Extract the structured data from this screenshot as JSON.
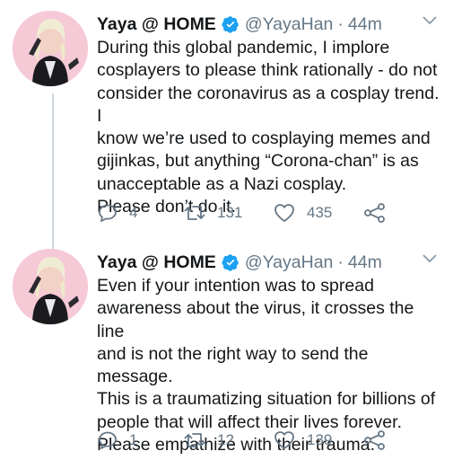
{
  "colors": {
    "text": "#14171a",
    "muted": "#657786",
    "verified": "#1da1f2",
    "thread_line": "#cfd9de"
  },
  "tweets": [
    {
      "author": {
        "name": "Yaya @ HOME",
        "handle": "@YayaHan",
        "verified_icon": "verified-badge-icon"
      },
      "separator": "·",
      "time": "44m",
      "lines": [
        "During this global pandemic, I implore",
        "cosplayers to please think rationally - do not",
        "consider the coronavirus as a cosplay trend. I",
        "know we’re used to cosplaying memes and",
        "gijinkas, but anything “Corona-chan” is as",
        "unacceptable as a Nazi cosplay.",
        "Please don’t do it."
      ],
      "stats": {
        "replies": "4",
        "retweets": "131",
        "likes": "435"
      }
    },
    {
      "author": {
        "name": "Yaya @ HOME",
        "handle": "@YayaHan",
        "verified_icon": "verified-badge-icon"
      },
      "separator": "·",
      "time": "44m",
      "lines": [
        "Even if your intention was to spread",
        "awareness about the virus, it crosses the line",
        "and is not the right way to send the message.",
        "This is a traumatizing situation for billions of",
        "people that will affect their lives forever.",
        "Please empathize with their trauma."
      ],
      "stats": {
        "replies": "1",
        "retweets": "12",
        "likes": "139"
      }
    }
  ]
}
